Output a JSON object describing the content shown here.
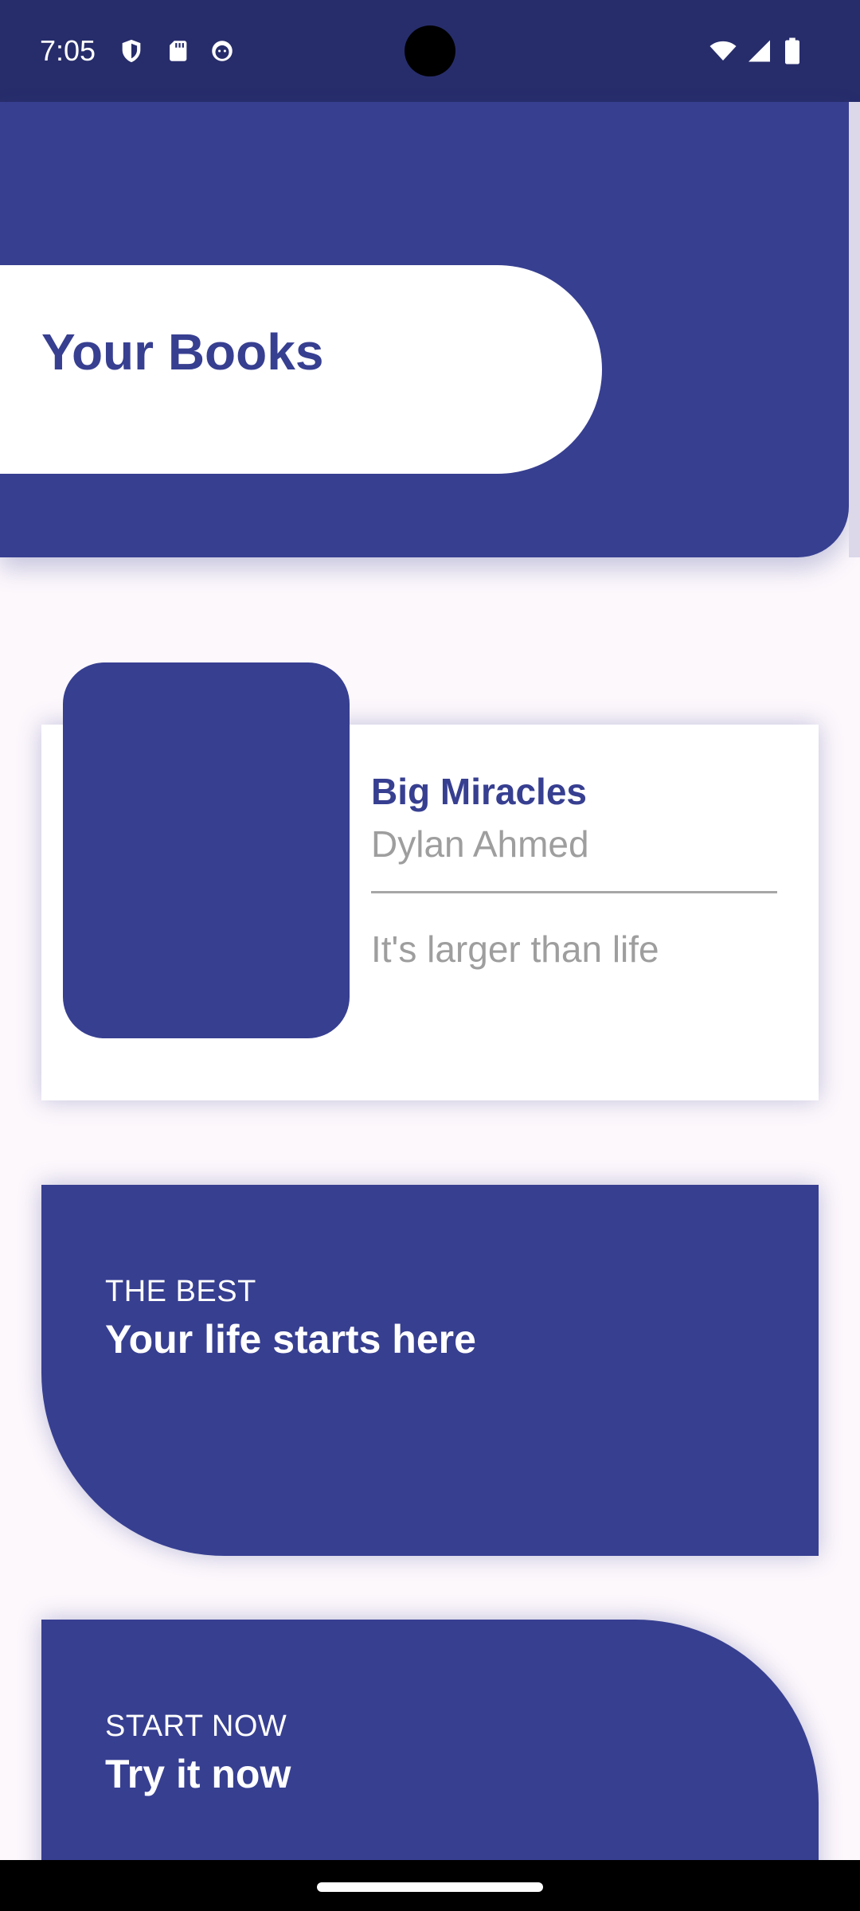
{
  "status_bar": {
    "time": "7:05",
    "left_icons": [
      "shield-icon",
      "sd-card-icon",
      "android-face-icon"
    ],
    "right_icons": [
      "wifi-icon",
      "cell-signal-icon",
      "battery-icon"
    ]
  },
  "header": {
    "title": "Your Books"
  },
  "book": {
    "title": "Big Miracles",
    "author": "Dylan Ahmed",
    "tagline": "It's larger than life"
  },
  "promos": [
    {
      "eyebrow": "THE BEST",
      "heading": "Your life starts here"
    },
    {
      "eyebrow": "START NOW",
      "heading": "Try it now"
    }
  ],
  "colors": {
    "primary": "#373f91",
    "status_bar": "#272d6b",
    "background": "#fdf8fc",
    "muted_text": "#9e9e9e"
  }
}
